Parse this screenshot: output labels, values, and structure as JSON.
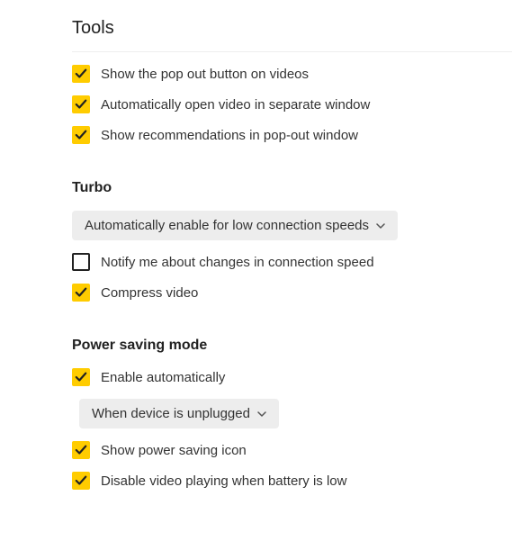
{
  "tools": {
    "title": "Tools",
    "items": [
      {
        "label": "Show the pop out button on videos",
        "checked": true
      },
      {
        "label": "Automatically open video in separate window",
        "checked": true
      },
      {
        "label": "Show recommendations in pop-out window",
        "checked": true
      }
    ]
  },
  "turbo": {
    "title": "Turbo",
    "dropdown": "Automatically enable for low connection speeds",
    "items": [
      {
        "label": "Notify me about changes in connection speed",
        "checked": false
      },
      {
        "label": "Compress video",
        "checked": true
      }
    ]
  },
  "power": {
    "title": "Power saving mode",
    "enable": {
      "label": "Enable automatically",
      "checked": true
    },
    "dropdown": "When device is unplugged",
    "items": [
      {
        "label": "Show power saving icon",
        "checked": true
      },
      {
        "label": "Disable video playing when battery is low",
        "checked": true
      }
    ]
  }
}
